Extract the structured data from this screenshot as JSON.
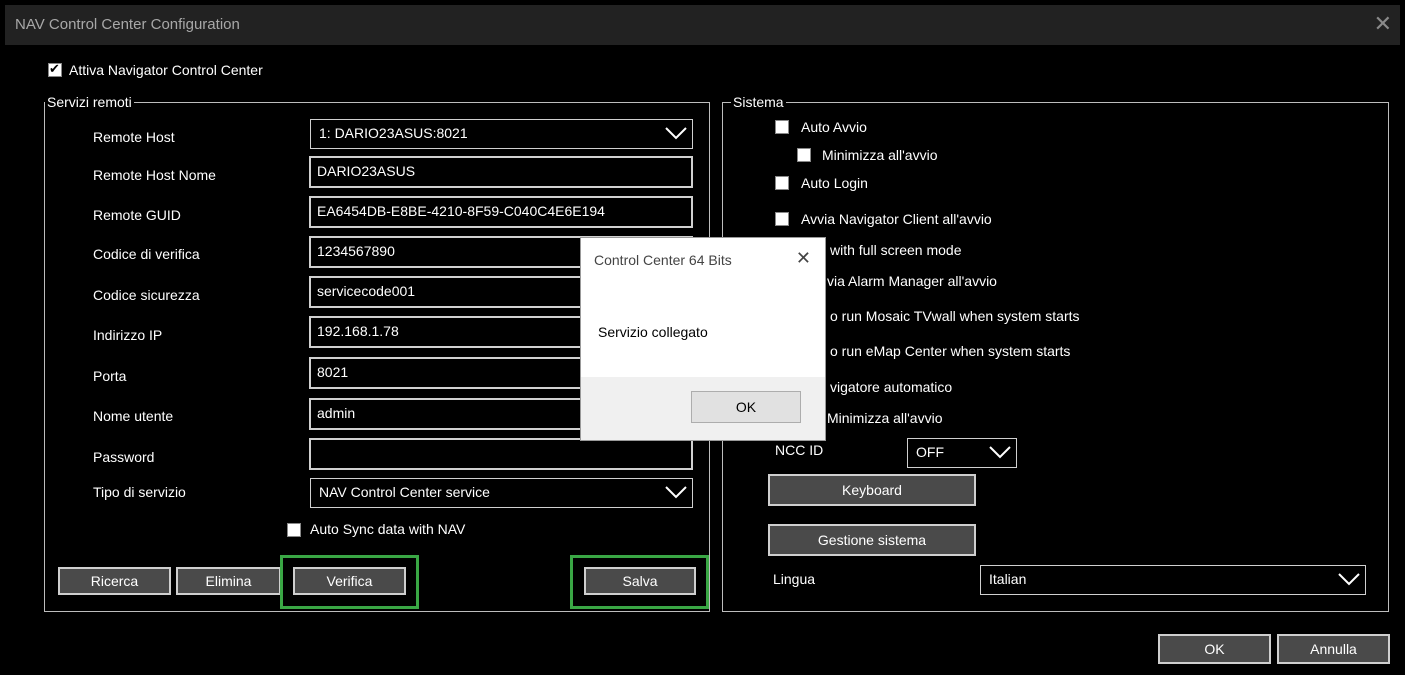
{
  "window": {
    "title": "NAV Control Center Configuration"
  },
  "enable_checkbox": {
    "label": "Attiva Navigator Control Center",
    "checked": true
  },
  "remote_services": {
    "legend": "Servizi remoti",
    "remote_host": {
      "label": "Remote Host",
      "value": "1: DARIO23ASUS:8021"
    },
    "remote_host_name": {
      "label": "Remote Host Nome",
      "value": "DARIO23ASUS"
    },
    "remote_guid": {
      "label": "Remote GUID",
      "value": "EA6454DB-E8BE-4210-8F59-C040C4E6E194"
    },
    "verify_code": {
      "label": "Codice di verifica",
      "value": "1234567890"
    },
    "security_code": {
      "label": "Codice sicurezza",
      "value": "servicecode001"
    },
    "ip_address": {
      "label": "Indirizzo IP",
      "value": "192.168.1.78"
    },
    "port": {
      "label": "Porta",
      "value": "8021"
    },
    "username": {
      "label": "Nome utente",
      "value": "admin"
    },
    "password": {
      "label": "Password",
      "value": ""
    },
    "service_type": {
      "label": "Tipo di servizio",
      "value": "NAV Control Center service"
    },
    "auto_sync": {
      "label": "Auto Sync data with NAV",
      "checked": false
    },
    "buttons": {
      "search": "Ricerca",
      "delete": "Elimina",
      "verify": "Verifica",
      "save": "Salva"
    }
  },
  "system": {
    "legend": "Sistema",
    "auto_start": "Auto Avvio",
    "auto_start_minimize": "Minimizza all'avvio",
    "auto_login": "Auto Login",
    "start_client": "Avvia Navigator Client all'avvio",
    "full_screen": "with full screen mode",
    "alarm_manager": "via Alarm Manager all'avvio",
    "mosaic": "o run Mosaic TVwall when system starts",
    "emap": "o run eMap Center when system starts",
    "auto_navigator": "vigatore automatico",
    "auto_navigator_minimize": "Minimizza all'avvio",
    "ncc_id": {
      "label": "NCC ID",
      "value": "OFF"
    },
    "keyboard_button": "Keyboard",
    "system_management_button": "Gestione sistema",
    "language": {
      "label": "Lingua",
      "value": "Italian"
    }
  },
  "footer": {
    "ok": "OK",
    "cancel": "Annulla"
  },
  "dialog": {
    "title": "Control Center 64 Bits",
    "message": "Servizio collegato",
    "ok": "OK"
  },
  "colors": {
    "highlight": "#3aa745",
    "background": "#000000"
  }
}
